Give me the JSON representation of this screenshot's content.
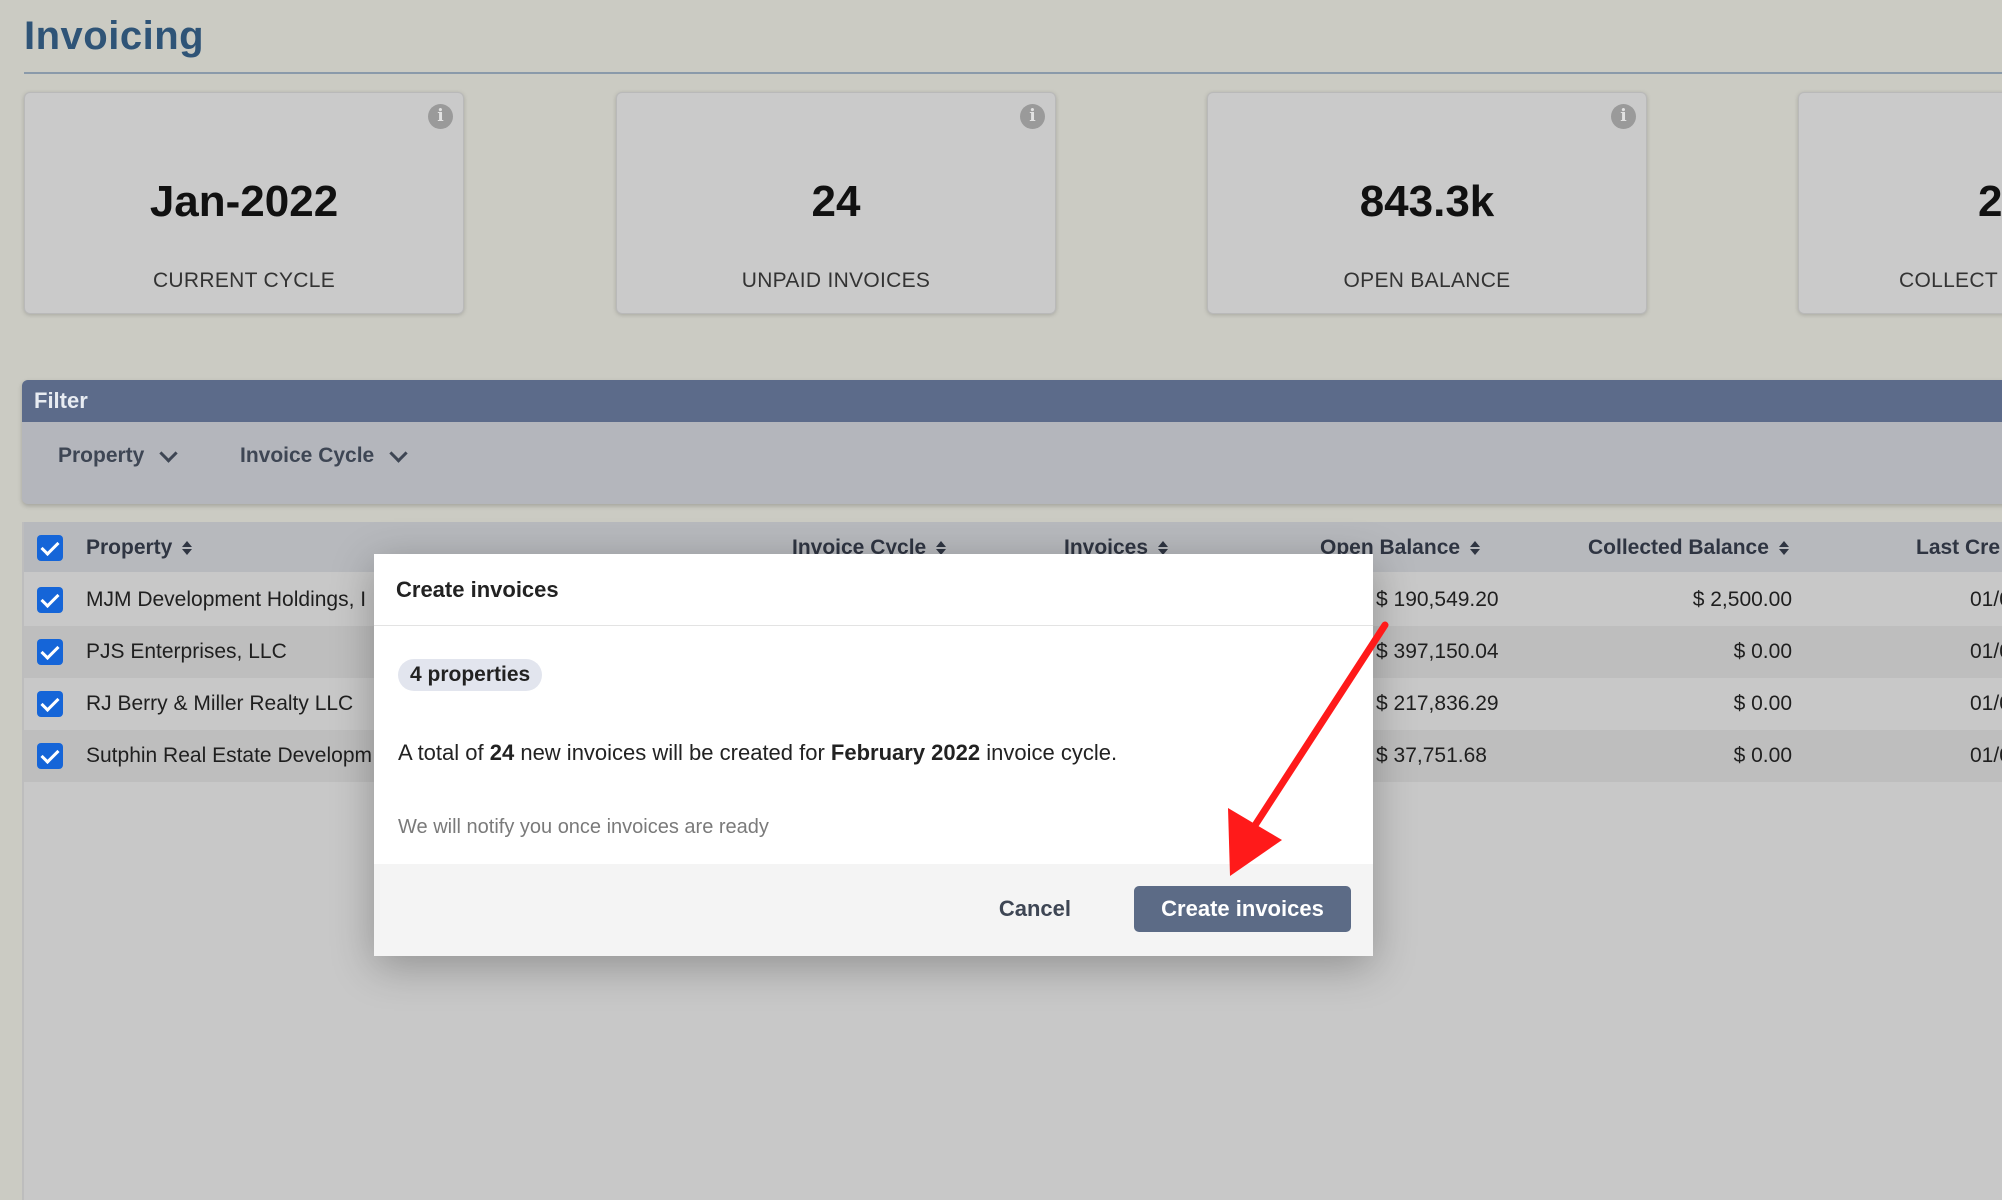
{
  "page": {
    "title": "Invoicing"
  },
  "stats": [
    {
      "value": "Jan-2022",
      "label": "CURRENT CYCLE",
      "info": "i"
    },
    {
      "value": "24",
      "label": "UNPAID INVOICES",
      "info": "i"
    },
    {
      "value": "843.3k",
      "label": "OPEN BALANCE",
      "info": "i"
    },
    {
      "value": "2",
      "label": "COLLECT",
      "info": "i"
    }
  ],
  "filter": {
    "title": "Filter",
    "dropdowns": [
      "Property",
      "Invoice Cycle"
    ]
  },
  "table": {
    "columns": [
      "Property",
      "Invoice Cycle",
      "Invoices",
      "Open Balance",
      "Collected Balance",
      "Last Cre"
    ],
    "rows": [
      {
        "property": "MJM Development Holdings, I",
        "open_balance": "$ 190,549.20",
        "collected": "$ 2,500.00",
        "last": "01/0"
      },
      {
        "property": "PJS Enterprises, LLC",
        "open_balance": "$ 397,150.04",
        "collected": "$ 0.00",
        "last": "01/0"
      },
      {
        "property": "RJ Berry & Miller Realty LLC",
        "open_balance": "$ 217,836.29",
        "collected": "$ 0.00",
        "last": "01/0"
      },
      {
        "property": "Sutphin Real Estate Developm",
        "open_balance": "$ 37,751.68",
        "collected": "$ 0.00",
        "last": "01/0"
      }
    ]
  },
  "modal": {
    "title": "Create invoices",
    "chip": "4 properties",
    "summary_pre": "A total of ",
    "summary_count": "24",
    "summary_mid": " new invoices will be created for ",
    "summary_cycle": "February 2022",
    "summary_post": " invoice cycle.",
    "note": "We will notify you once invoices are ready",
    "cancel_label": "Cancel",
    "create_label": "Create invoices"
  },
  "colors": {
    "accent": "#5c6b86",
    "annotation_arrow": "#ff1a1a",
    "checkbox": "#1565d8",
    "title": "#2f5477"
  }
}
